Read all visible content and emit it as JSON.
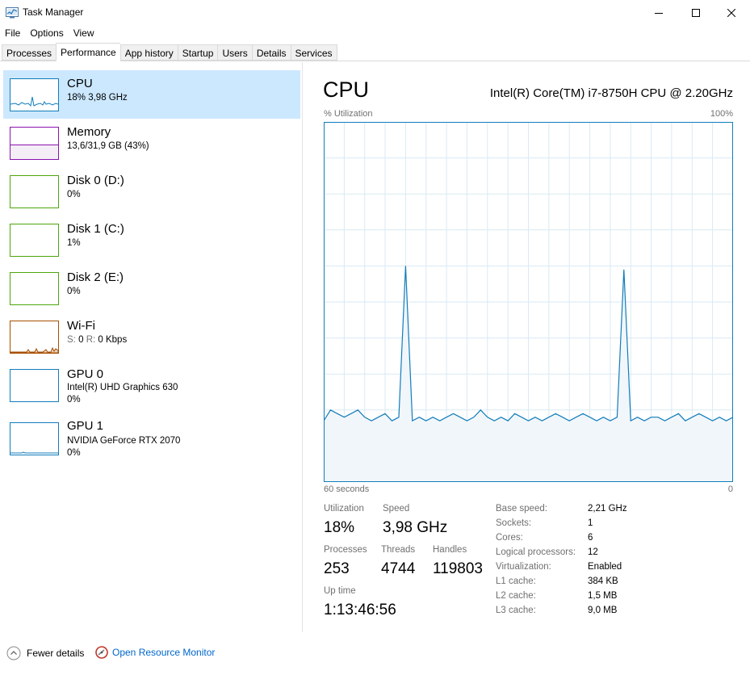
{
  "window": {
    "title": "Task Manager"
  },
  "menu": [
    "File",
    "Options",
    "View"
  ],
  "tabs": [
    "Processes",
    "Performance",
    "App history",
    "Startup",
    "Users",
    "Details",
    "Services"
  ],
  "active_tab": "Performance",
  "sidebar": {
    "items": [
      {
        "name": "CPU",
        "line1": "18%  3,98 GHz",
        "line2": "",
        "color": "#117dbb",
        "icon": "cpu-graph-thumbnail"
      },
      {
        "name": "Memory",
        "line1": "13,6/31,9 GB (43%)",
        "line2": "",
        "color": "#8b12ae",
        "icon": "memory-graph-thumbnail"
      },
      {
        "name": "Disk 0 (D:)",
        "line1": "0%",
        "line2": "",
        "color": "#4da60c",
        "icon": "disk-graph-thumbnail"
      },
      {
        "name": "Disk 1 (C:)",
        "line1": "1%",
        "line2": "",
        "color": "#4da60c",
        "icon": "disk-graph-thumbnail"
      },
      {
        "name": "Disk 2 (E:)",
        "line1": "0%",
        "line2": "",
        "color": "#4da60c",
        "icon": "disk-graph-thumbnail"
      },
      {
        "name": "Wi-Fi",
        "line1": "",
        "line2": "",
        "color": "#a74f01",
        "icon": "wifi-graph-thumbnail",
        "wifi_s_label": "S:",
        "wifi_s_value": "0",
        "wifi_r_label": "R:",
        "wifi_r_value": "0 Kbps"
      },
      {
        "name": "GPU 0",
        "line1": "Intel(R) UHD Graphics 630",
        "line2": "0%",
        "color": "#117dbb",
        "icon": "gpu-graph-thumbnail"
      },
      {
        "name": "GPU 1",
        "line1": "NVIDIA GeForce RTX 2070",
        "line2": "0%",
        "color": "#117dbb",
        "icon": "gpu-graph-thumbnail"
      }
    ]
  },
  "main": {
    "title": "CPU",
    "model": "Intel(R) Core(TM) i7-8750H CPU @ 2.20GHz",
    "graph": {
      "y_label": "% Utilization",
      "y_max_label": "100%",
      "x_left_label": "60 seconds",
      "x_right_label": "0",
      "line_color": "#117dbb",
      "fill_color": "#f1f6fa",
      "grid_color": "#d9eaf4",
      "utilization_percent": [
        17,
        20,
        19,
        18,
        19,
        20,
        18,
        17,
        18,
        19,
        17,
        18,
        60,
        17,
        18,
        17,
        18,
        17,
        18,
        19,
        18,
        17,
        18,
        20,
        18,
        17,
        18,
        17,
        19,
        18,
        17,
        18,
        17,
        18,
        19,
        18,
        17,
        18,
        19,
        18,
        17,
        18,
        17,
        18,
        59,
        17,
        18,
        17,
        18,
        18,
        17,
        18,
        19,
        17,
        18,
        19,
        18,
        17,
        18,
        17,
        18
      ]
    },
    "stats": {
      "utilization_label": "Utilization",
      "utilization": "18%",
      "speed_label": "Speed",
      "speed": "3,98 GHz",
      "processes_label": "Processes",
      "processes": "253",
      "threads_label": "Threads",
      "threads": "4744",
      "handles_label": "Handles",
      "handles": "119803",
      "uptime_label": "Up time",
      "uptime": "1:13:46:56"
    },
    "specs": [
      {
        "label": "Base speed:",
        "value": "2,21 GHz"
      },
      {
        "label": "Sockets:",
        "value": "1"
      },
      {
        "label": "Cores:",
        "value": "6"
      },
      {
        "label": "Logical processors:",
        "value": "12"
      },
      {
        "label": "Virtualization:",
        "value": "Enabled"
      },
      {
        "label": "L1 cache:",
        "value": "384 KB"
      },
      {
        "label": "L2 cache:",
        "value": "1,5 MB"
      },
      {
        "label": "L3 cache:",
        "value": "9,0 MB"
      }
    ]
  },
  "footer": {
    "fewer_details": "Fewer details",
    "open_resource_monitor": "Open Resource Monitor"
  }
}
